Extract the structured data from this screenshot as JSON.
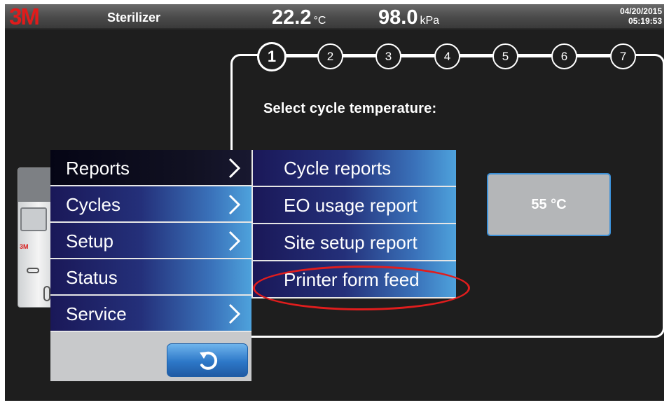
{
  "header": {
    "logo": "3M",
    "title": "Sterilizer",
    "temperature": {
      "value": "22.2",
      "unit": "°C"
    },
    "pressure": {
      "value": "98.0",
      "unit": "kPa"
    },
    "date": "04/20/2015",
    "time": "05:19:53"
  },
  "wizard": {
    "steps": [
      "1",
      "2",
      "3",
      "4",
      "5",
      "6",
      "7"
    ],
    "active_step": 1,
    "prompt": "Select cycle temperature:",
    "temperature_option": "55 °C"
  },
  "device": {
    "logo": "3M"
  },
  "main_menu": {
    "items": [
      {
        "label": "Reports",
        "has_submenu": true,
        "selected": true
      },
      {
        "label": "Cycles",
        "has_submenu": true,
        "selected": false
      },
      {
        "label": "Setup",
        "has_submenu": true,
        "selected": false
      },
      {
        "label": "Status",
        "has_submenu": false,
        "selected": false
      },
      {
        "label": "Service",
        "has_submenu": true,
        "selected": false
      }
    ],
    "back_icon": "undo-arrow-icon"
  },
  "sub_menu": {
    "items": [
      {
        "label": "Cycle reports"
      },
      {
        "label": "EO usage report"
      },
      {
        "label": "Site setup report"
      },
      {
        "label": "Printer form feed"
      }
    ],
    "highlighted_index": 3
  },
  "colors": {
    "brand_red": "#e11b1b",
    "menu_blue_dark": "#1a1858",
    "menu_blue_light": "#4ea2dc",
    "highlight_red": "#e11d1d"
  }
}
